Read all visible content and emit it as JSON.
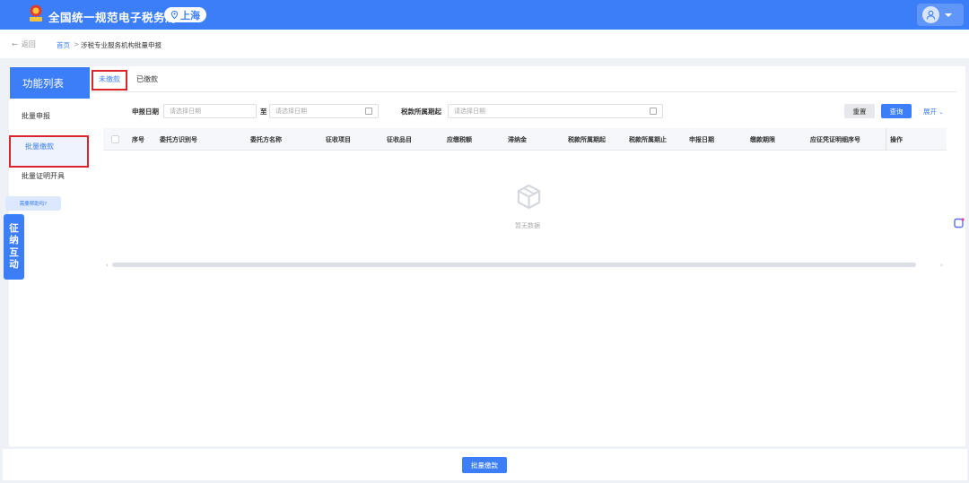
{
  "header": {
    "site_title": "全国统一规范电子税务局",
    "region": "上海"
  },
  "breadcrumb": {
    "back": "返回",
    "home": "首页",
    "separator": ">",
    "current": "涉税专业服务机构批量申报"
  },
  "sidebar": {
    "title": "功能列表",
    "items": [
      {
        "label": "批量申报"
      },
      {
        "label": "批量缴款"
      },
      {
        "label": "批量证明开具"
      }
    ],
    "help": "需要帮助吗?",
    "interact": [
      "征",
      "纳",
      "互",
      "动"
    ]
  },
  "tabs": [
    {
      "label": "未缴款"
    },
    {
      "label": "已缴款"
    }
  ],
  "filters": {
    "declare_date_label": "申报日期",
    "start_placeholder": "请选择日期",
    "to": "至",
    "end_placeholder": "请选择日期",
    "period_label": "税款所属期起",
    "period_placeholder": "请选择日期",
    "reset": "重置",
    "query": "查询",
    "expand": "展开"
  },
  "table": {
    "columns": [
      "序号",
      "委托方识别号",
      "委托方名称",
      "征收项目",
      "征收品目",
      "应缴税额",
      "滞纳金",
      "税款所属期起",
      "税款所属期止",
      "申报日期",
      "缴款期限",
      "应征凭证明细序号",
      "操作"
    ],
    "empty_text": "暂无数据"
  },
  "footer": {
    "batch_pay": "批量缴款"
  },
  "colors": {
    "primary": "#3c7ef7",
    "highlight_border": "#d9252b"
  }
}
